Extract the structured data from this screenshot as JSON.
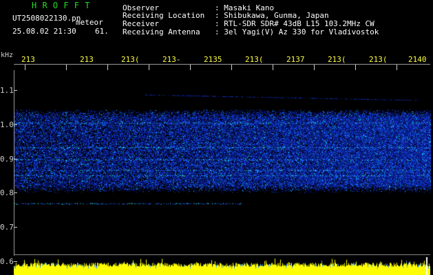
{
  "header": {
    "title": "H R O F F T",
    "file_name": "UT2508022130.pn",
    "type": "meteor",
    "datetime": "25.08.02 21:30",
    "count": "61.",
    "fields": [
      {
        "label": "Observer",
        "value": ": Masaki Kano"
      },
      {
        "label": "Receiving Location",
        "value": ": Shibukawa, Gunma, Japan"
      },
      {
        "label": "Receiver",
        "value": ": RTL-SDR SDR# 43dB L15 103.2MHz CW"
      },
      {
        "label": "Receiving Antenna",
        "value": ": 3el Yagi(V) Az 330 for Vladivostok"
      }
    ]
  },
  "axes": {
    "y_unit": "kHz",
    "y_labels": [
      "1.1",
      "1.0",
      "0.9",
      "0.8",
      "0.7",
      "0.6"
    ],
    "x_labels": [
      "213",
      "213",
      "213(",
      "213-",
      "2135",
      "213(",
      "2137",
      "213(",
      "213(",
      "2140"
    ]
  },
  "colors": {
    "title": "#22dd22",
    "labels": "#66bbff",
    "x_ticks": "#ffff44",
    "spectrum_low": "#0a1a8a",
    "spectrum_high": "#00ffff",
    "signal_bar": "#ffff00"
  },
  "display": {
    "y_range_khz": [
      0.6,
      1.13
    ],
    "noise_band_khz": [
      0.78,
      1.02
    ],
    "signal_lines_khz": [
      0.98,
      0.91,
      0.875,
      0.845,
      0.83,
      0.75
    ]
  }
}
